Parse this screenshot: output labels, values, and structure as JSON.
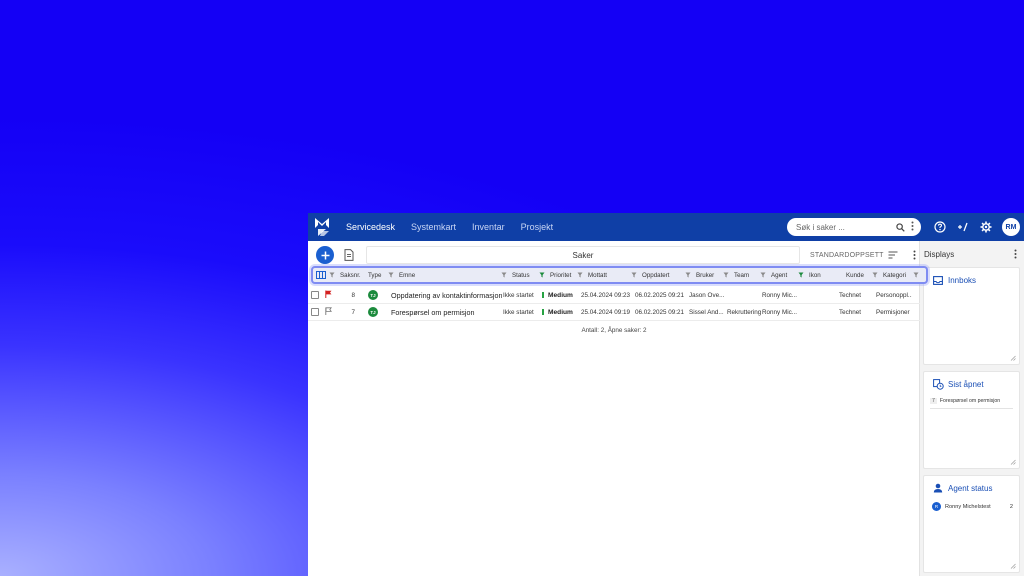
{
  "nav": {
    "items": [
      {
        "label": "Servicedesk",
        "active": true
      },
      {
        "label": "Systemkart",
        "active": false
      },
      {
        "label": "Inventar",
        "active": false
      },
      {
        "label": "Prosjekt",
        "active": false
      }
    ],
    "search_placeholder": "Søk i saker ...",
    "avatar_initials": "RM"
  },
  "toolbar": {
    "title": "Saker",
    "layout_label": "STANDARDOPPSETT"
  },
  "table": {
    "columns": [
      "Saksnr.",
      "Type",
      "Emne",
      "Status",
      "Prioritet",
      "Mottatt",
      "Oppdatert",
      "Bruker",
      "Team",
      "Agent",
      "Ikon",
      "Kunde",
      "Kategori"
    ],
    "active_filters": [
      "Prioritet",
      "Agent"
    ],
    "rows": [
      {
        "flag": "red",
        "saksnr": "8",
        "type": "TJ",
        "emne": "Oppdatering av kontaktinformasjon",
        "status": "Ikke startet",
        "prioritet": "Medium",
        "mottatt": "25.04.2024 09:23",
        "oppdatert": "06.02.2025 09:21",
        "bruker": "Jason Ove...",
        "team": "",
        "agent": "Ronny Mic...",
        "ikon": "",
        "kunde": "Technet",
        "kategori": "Personoppl..."
      },
      {
        "flag": "outline",
        "saksnr": "7",
        "type": "TJ",
        "emne": "Forespørsel om permisjon",
        "status": "Ikke startet",
        "prioritet": "Medium",
        "mottatt": "25.04.2024 09:19",
        "oppdatert": "06.02.2025 09:21",
        "bruker": "Sissel And...",
        "team": "Rekruttering -",
        "agent": "Ronny Mic...",
        "ikon": "",
        "kunde": "Technet",
        "kategori": "Permisjoner"
      }
    ],
    "footer": "Antall: 2, Åpne saker: 2"
  },
  "displays": {
    "title": "Displays",
    "inbox_title": "Innboks",
    "recent_title": "Sist åpnet",
    "recent_items": [
      {
        "num": "7",
        "label": "Forespørsel om permisjon"
      }
    ],
    "agent_title": "Agent status",
    "agents": [
      {
        "initial": "R",
        "name": "Ronny Michelstest",
        "count": "2"
      }
    ]
  },
  "colors": {
    "topbar": "#0f3fa6",
    "accent": "#1a5fd0",
    "type_badge": "#1b8a3c",
    "priority_medium": "#27a243",
    "flag_red": "#d32020",
    "header_highlight": "#7f8cf2"
  }
}
